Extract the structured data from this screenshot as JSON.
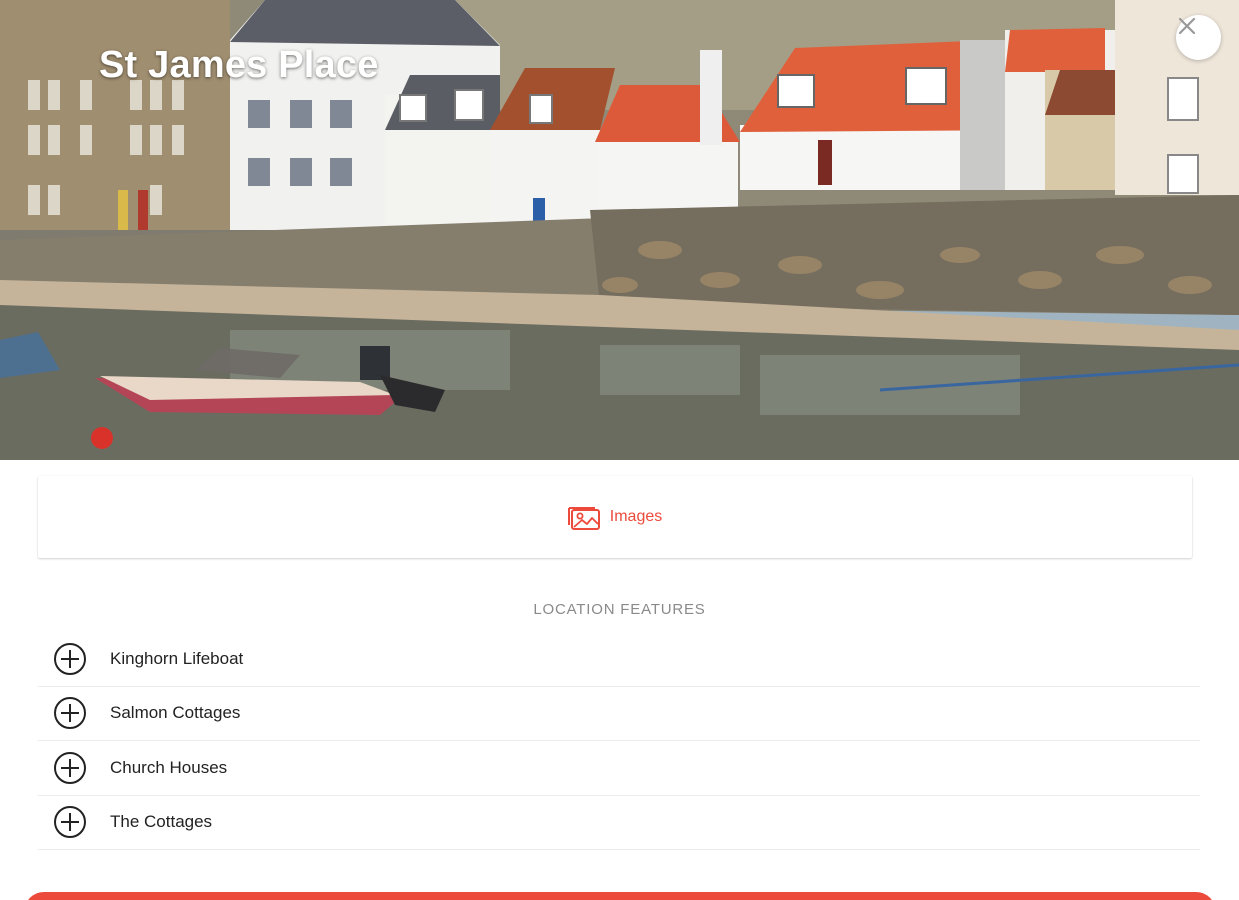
{
  "header": {
    "title": "St James Place",
    "close_icon": "close-icon"
  },
  "tabs": {
    "images_label": "Images",
    "images_icon": "images-icon",
    "accent_color": "#ec4b3c"
  },
  "features": {
    "heading": "LOCATION FEATURES",
    "items": [
      {
        "label": "Kinghorn Lifeboat",
        "icon": "plus-circle-icon"
      },
      {
        "label": "Salmon Cottages",
        "icon": "plus-circle-icon"
      },
      {
        "label": "Church Houses",
        "icon": "plus-circle-icon"
      },
      {
        "label": "The Cottages",
        "icon": "plus-circle-icon"
      }
    ]
  },
  "cta": {
    "color": "#ec4b3c"
  }
}
